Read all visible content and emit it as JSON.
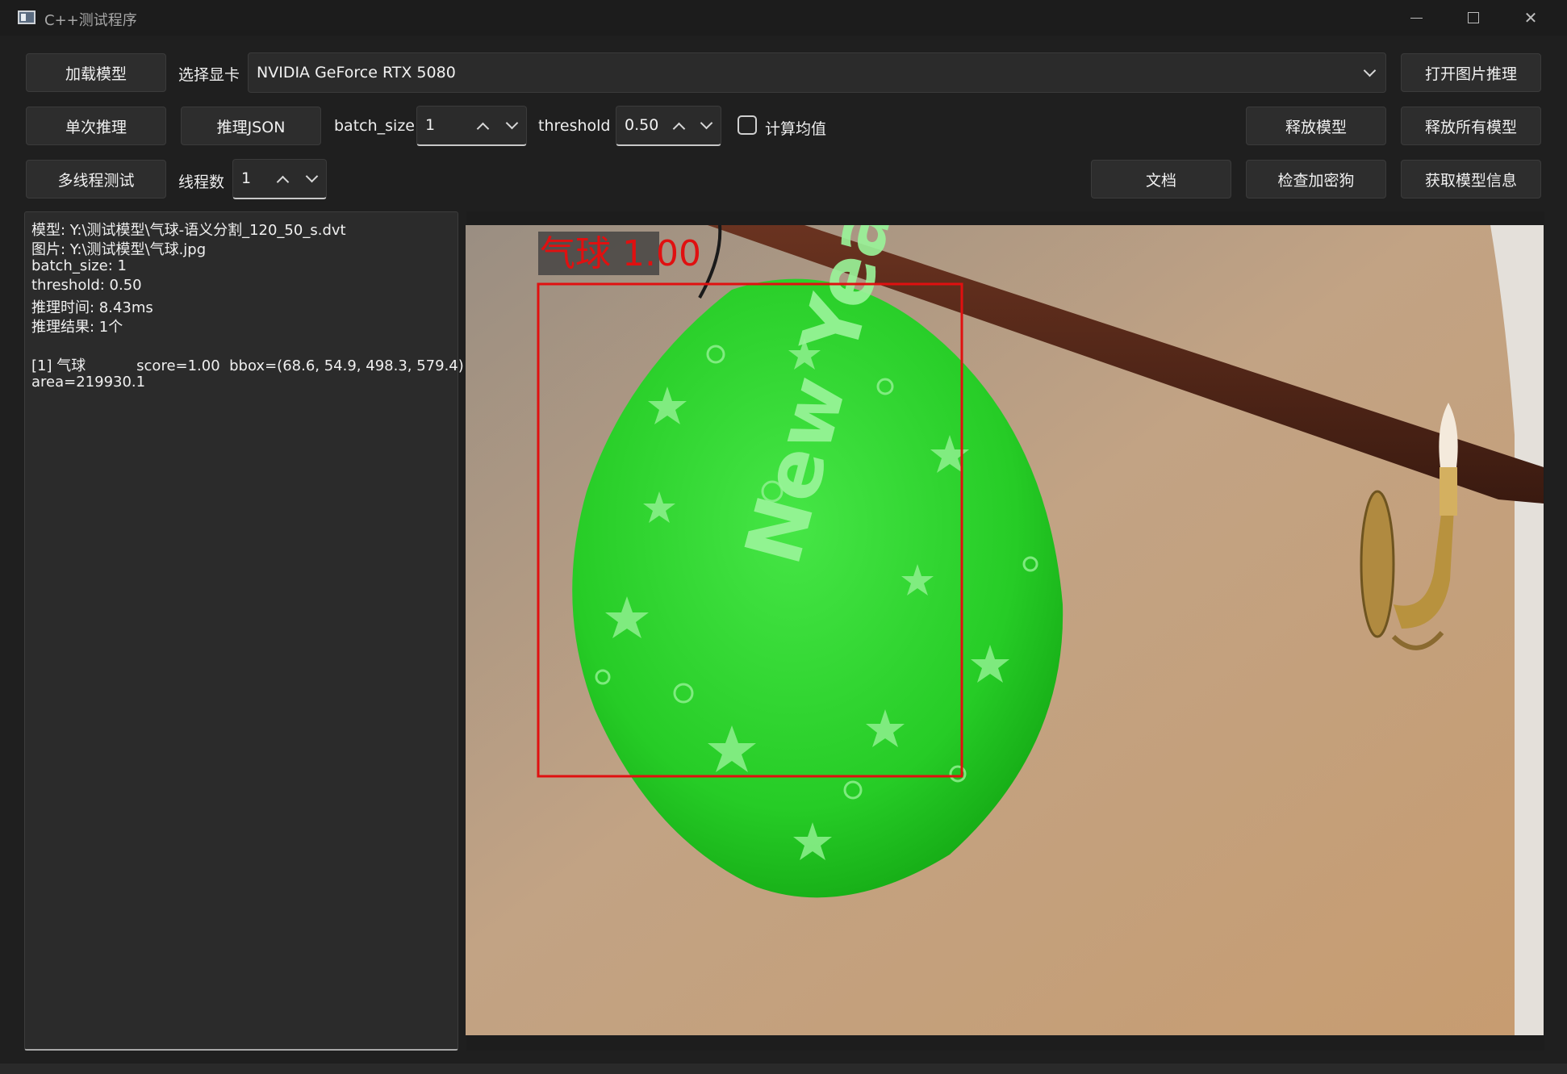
{
  "window": {
    "title": "C++测试程序",
    "controls": {
      "minimize_icon": "minimize-icon",
      "maximize_icon": "maximize-icon",
      "close_icon": "close-icon",
      "close_glyph": "✕"
    }
  },
  "toolbar": {
    "row1": {
      "load_model": "加载模型",
      "gpu_label": "选择显卡",
      "gpu_value": "NVIDIA GeForce RTX 5080",
      "open_image": "打开图片推理"
    },
    "row2": {
      "single_infer": "单次推理",
      "infer_json": "推理JSON",
      "batch_label": "batch_size",
      "batch_value": "1",
      "threshold_label": "threshold",
      "threshold_value": "0.50",
      "mean_checkbox_label": "计算均值",
      "mean_checked": false,
      "release_model": "释放模型",
      "release_all": "释放所有模型"
    },
    "row3": {
      "multithread_test": "多线程测试",
      "threads_label": "线程数",
      "threads_value": "1",
      "docs": "文档",
      "check_dongle": "检查加密狗",
      "model_info": "获取模型信息"
    }
  },
  "log": {
    "lines": [
      "模型: Y:\\测试模型\\气球-语义分割_120_50_s.dvt",
      "图片: Y:\\测试模型\\气球.jpg",
      "batch_size: 1",
      "threshold: 0.50",
      "推理时间: 8.43ms",
      "推理结果: 1个",
      "",
      "[1] 气球           score=1.00  bbox=(68.6, 54.9, 498.3, 579.4)",
      "area=219930.1"
    ]
  },
  "result_image": {
    "detection_label": "气球 1.00",
    "box_color": "#e01010",
    "mask_color": "#22dd22",
    "balloon_text": "New Year"
  }
}
